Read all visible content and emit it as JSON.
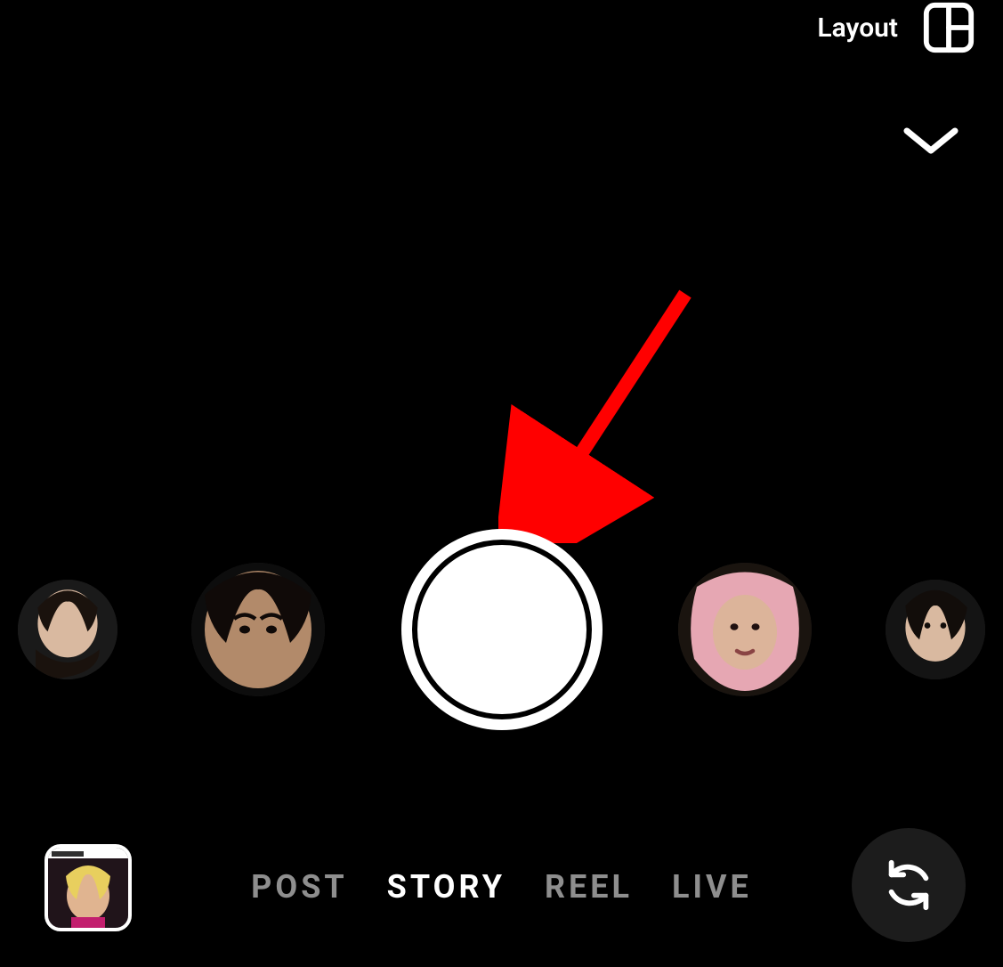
{
  "top_tools": {
    "layout_label": "Layout"
  },
  "effects": [
    {
      "name": "effect-filter-1"
    },
    {
      "name": "effect-filter-2"
    },
    {
      "name": "effect-filter-3"
    },
    {
      "name": "effect-filter-4"
    }
  ],
  "modes": {
    "items": [
      "POST",
      "STORY",
      "REEL",
      "LIVE"
    ],
    "active_index": 1
  },
  "annotation": {
    "arrow_color": "#ff0000"
  }
}
